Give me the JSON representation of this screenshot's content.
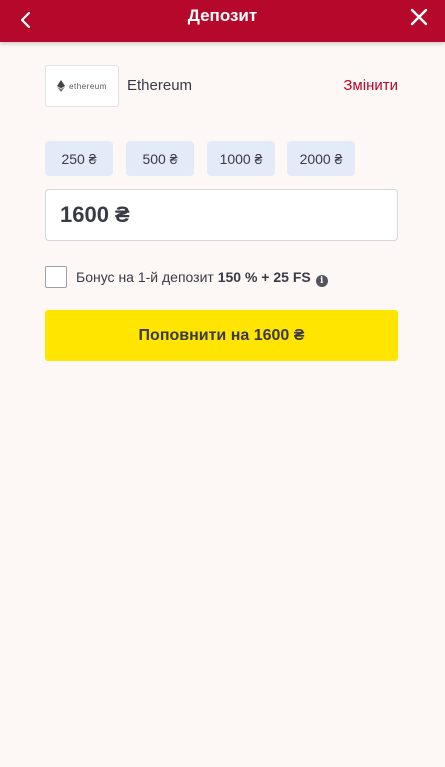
{
  "header": {
    "title": "Депозит",
    "back_icon": "chevron-left-icon",
    "close_icon": "close-icon"
  },
  "payment_method": {
    "logo_text": "ethereum",
    "name": "Ethereum",
    "change_label": "Змінити"
  },
  "quick_amounts": [
    "250 ₴",
    "500 ₴",
    "1000 ₴",
    "2000 ₴"
  ],
  "amount": {
    "value": "1600 ₴"
  },
  "bonus": {
    "checked": false,
    "label": "Бонус на 1-й депозит ",
    "highlight": "150 % + 25 FS",
    "info_icon": "info-icon"
  },
  "submit": {
    "label": "Поповнити на 1600 ₴"
  },
  "colors": {
    "header_bg": "#b5082a",
    "accent": "#b5082a",
    "button_bg": "#ffe500",
    "chip_bg": "#e4ebf8",
    "page_bg": "#fdf8f5"
  }
}
